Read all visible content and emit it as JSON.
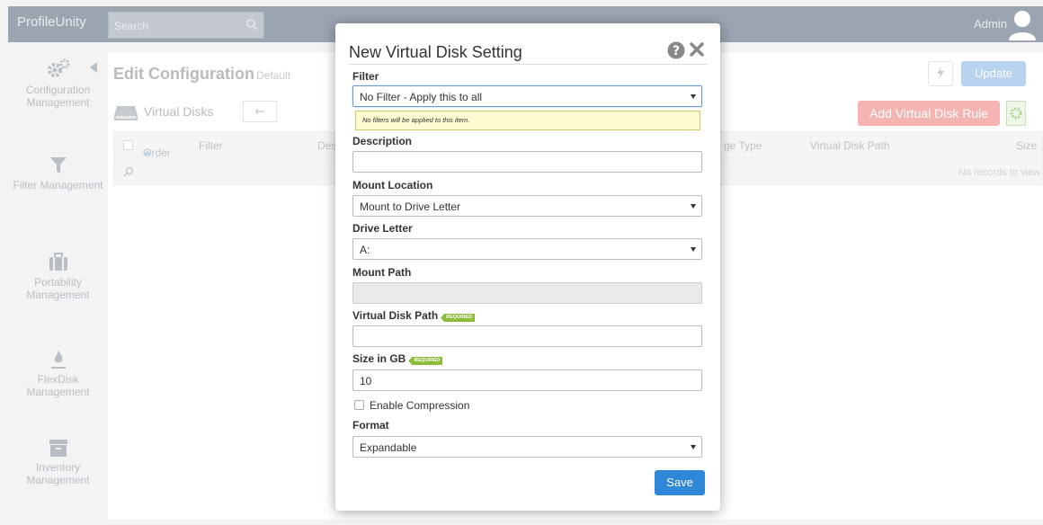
{
  "topbar": {
    "brand": "ProfileUnity",
    "search_placeholder": "Search",
    "user": "Admin"
  },
  "sidebar": {
    "items": [
      {
        "label": "Configuration Management",
        "icon": "gears-icon"
      },
      {
        "label": "Filter Management",
        "icon": "filter-icon"
      },
      {
        "label": "Portability Management",
        "icon": "suitcase-icon"
      },
      {
        "label": "FlexDisk Management",
        "icon": "flame-icon"
      },
      {
        "label": "Inventory Management",
        "icon": "archive-icon"
      }
    ]
  },
  "main": {
    "title": "Edit Configuration",
    "subtitle": "Default",
    "update_label": "Update",
    "section_title": "Virtual Disks",
    "add_rule_label": "Add Virtual Disk Rule",
    "grid_columns": [
      "Order",
      "Filter",
      "Desc",
      "ge Type",
      "Virtual Disk Path",
      "Size"
    ],
    "no_records": "No records to view"
  },
  "dialog": {
    "title": "New Virtual Disk Setting",
    "filter_label": "Filter",
    "filter_value": "No Filter - Apply this to all",
    "filter_hint": "No filters will be applied to this item.",
    "description_label": "Description",
    "description_value": "",
    "mount_location_label": "Mount Location",
    "mount_location_value": "Mount to Drive Letter",
    "drive_letter_label": "Drive Letter",
    "drive_letter_value": "A:",
    "mount_path_label": "Mount Path",
    "mount_path_value": "",
    "vdisk_path_label": "Virtual Disk Path",
    "required_tag": "REQUIRED",
    "vdisk_path_value": "",
    "size_label": "Size in GB",
    "size_value": "10",
    "compression_label": "Enable Compression",
    "compression_checked": false,
    "format_label": "Format",
    "format_value": "Expandable",
    "save_label": "Save"
  },
  "colors": {
    "accent": "#2f87d8",
    "required": "#8bbd3b",
    "danger_faded": "#f5b3b2"
  }
}
